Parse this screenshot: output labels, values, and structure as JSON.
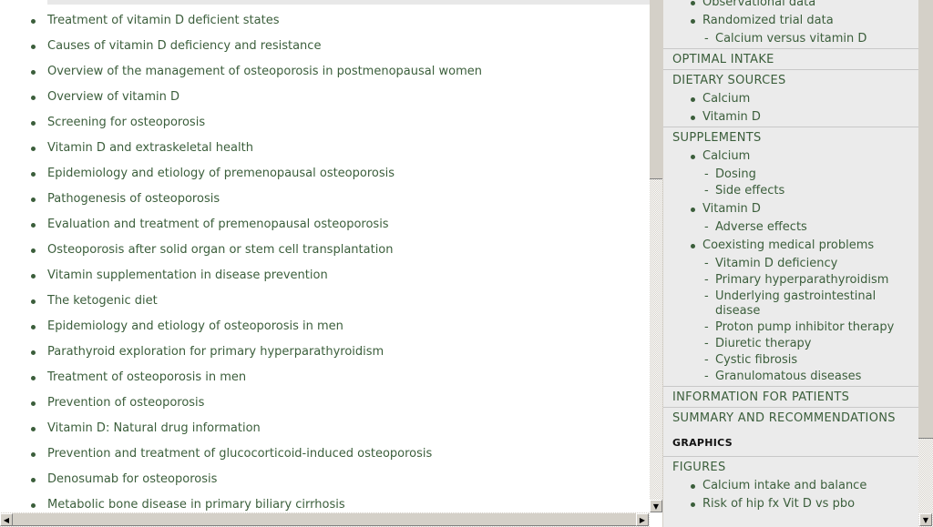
{
  "left_list": [
    "Treatment of vitamin D deficient states",
    "Causes of vitamin D deficiency and resistance",
    "Overview of the management of osteoporosis in postmenopausal women",
    "Overview of vitamin D",
    "Screening for osteoporosis",
    "Vitamin D and extraskeletal health",
    "Epidemiology and etiology of premenopausal osteoporosis",
    "Pathogenesis of osteoporosis",
    "Evaluation and treatment of premenopausal osteoporosis",
    "Osteoporosis after solid organ or stem cell transplantation",
    "Vitamin supplementation in disease prevention",
    "The ketogenic diet",
    "Epidemiology and etiology of osteoporosis in men",
    "Parathyroid exploration for primary hyperparathyroidism",
    "Treatment of osteoporosis in men",
    "Prevention of osteoporosis",
    "Vitamin D: Natural drug information",
    "Prevention and treatment of glucocorticoid-induced osteoporosis",
    "Denosumab for osteoporosis",
    "Metabolic bone disease in primary biliary cirrhosis"
  ],
  "toc": {
    "top_bullets": [
      "Observational data",
      "Randomized trial data"
    ],
    "top_dash": "Calcium versus vitamin D",
    "optimal_intake": "OPTIMAL INTAKE",
    "dietary_sources": "DIETARY SOURCES",
    "dietary_items": [
      "Calcium",
      "Vitamin D"
    ],
    "supplements": "SUPPLEMENTS",
    "supp_calcium": "Calcium",
    "supp_calcium_sub": [
      "Dosing",
      "Side effects"
    ],
    "supp_vitd": "Vitamin D",
    "supp_vitd_sub": [
      "Adverse effects"
    ],
    "coexisting": "Coexisting medical problems",
    "coexisting_sub": [
      "Vitamin D deficiency",
      "Primary hyperparathyroidism",
      "Underlying gastrointestinal disease",
      "Proton pump inhibitor therapy",
      "Diuretic therapy",
      "Cystic fibrosis",
      "Granulomatous diseases"
    ],
    "info_patients": "INFORMATION FOR PATIENTS",
    "summary": "SUMMARY AND RECOMMENDATIONS",
    "graphics": "GRAPHICS",
    "figures": "FIGURES",
    "figure_items": [
      "Calcium intake and balance",
      "Risk of hip fx Vit D vs pbo"
    ]
  },
  "colors": {
    "link": "#3b5e3b",
    "toc_bg": "#ebebeb",
    "scrollbar": "#d4d0c8"
  }
}
